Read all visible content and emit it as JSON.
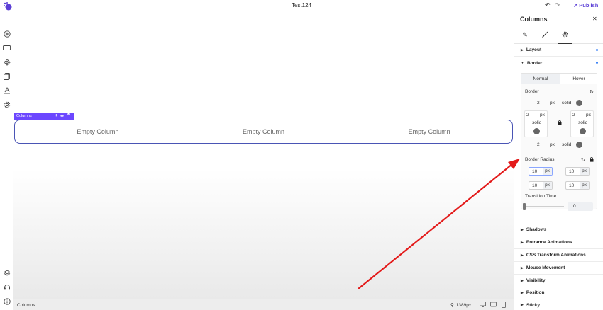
{
  "app": {
    "title": "Test124",
    "publish_label": "Publish",
    "accent": "#5b3fd6"
  },
  "canvas": {
    "selected_label": "Columns",
    "columns": [
      "Empty Column",
      "Empty Column",
      "Empty Column"
    ]
  },
  "statusbar": {
    "breadcrumb": "Columns",
    "zoom": "1389px"
  },
  "panel": {
    "title": "Columns",
    "tabs": [
      "pencil-icon",
      "brush-icon",
      "gear-icon"
    ],
    "active_tab": 2,
    "sections_top": [
      {
        "label": "Layout",
        "expanded": false,
        "modified": true
      },
      {
        "label": "Border",
        "expanded": true,
        "modified": true
      }
    ],
    "border": {
      "toggle": [
        "Normal",
        "Hover"
      ],
      "active_toggle": "Hover",
      "border_label": "Border",
      "top": {
        "value": "2",
        "unit": "px",
        "style": "solid"
      },
      "left": {
        "value": "2",
        "unit": "px",
        "style": "solid"
      },
      "right": {
        "value": "2",
        "unit": "px",
        "style": "solid"
      },
      "bottom": {
        "value": "2",
        "unit": "px",
        "style": "solid"
      },
      "radius_label": "Border Radius",
      "radius": [
        {
          "value": "10",
          "unit": "px"
        },
        {
          "value": "10",
          "unit": "px"
        },
        {
          "value": "10",
          "unit": "px"
        },
        {
          "value": "10",
          "unit": "px"
        }
      ],
      "transition_label": "Transition Time",
      "transition_value": "0"
    },
    "sections_bottom": [
      "Shadows",
      "Entrance Animations",
      "CSS Transform Animations",
      "Mouse Movement",
      "Visibility",
      "Position",
      "Sticky"
    ]
  }
}
